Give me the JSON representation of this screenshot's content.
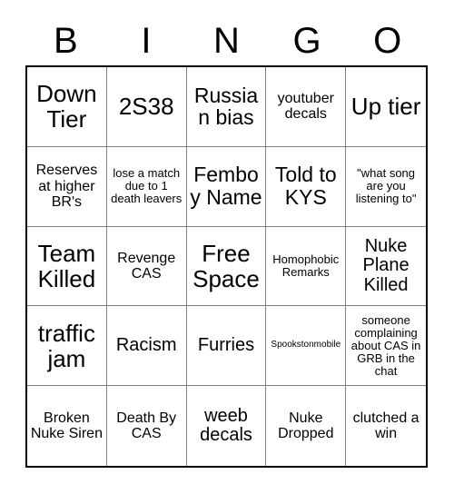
{
  "card": {
    "header_letters": [
      "B",
      "I",
      "N",
      "G",
      "O"
    ],
    "background_color": "#ffffff",
    "text_color": "#000000",
    "outer_border_color": "#000000",
    "inner_border_color": "#808080",
    "rows": 5,
    "columns": 5,
    "cells": [
      {
        "text": "Down Tier",
        "size": "fs-xl"
      },
      {
        "text": "2S38",
        "size": "fs-xl"
      },
      {
        "text": "Russian bias",
        "size": "fs-lg"
      },
      {
        "text": "youtuber decals",
        "size": "fs-sm"
      },
      {
        "text": "Up tier",
        "size": "fs-xl"
      },
      {
        "text": "Reserves at higher BR's",
        "size": "fs-sm"
      },
      {
        "text": "lose a match due to 1 death leavers",
        "size": "fs-xs"
      },
      {
        "text": "Femboy Name",
        "size": "fs-lg"
      },
      {
        "text": "Told to KYS",
        "size": "fs-lg"
      },
      {
        "text": "\"what song are you listening to\"",
        "size": "fs-xs"
      },
      {
        "text": "Team Killed",
        "size": "fs-xl"
      },
      {
        "text": "Revenge CAS",
        "size": "fs-sm"
      },
      {
        "text": "Free Space",
        "size": "fs-xl"
      },
      {
        "text": "Homophobic Remarks",
        "size": "fs-xs"
      },
      {
        "text": "Nuke Plane Killed",
        "size": "fs-md"
      },
      {
        "text": "traffic jam",
        "size": "fs-xl"
      },
      {
        "text": "Racism",
        "size": "fs-md"
      },
      {
        "text": "Furries",
        "size": "fs-md"
      },
      {
        "text": "Spookstonmobile",
        "size": "fs-xxs"
      },
      {
        "text": "someone complaining about CAS in GRB in the chat",
        "size": "fs-xs"
      },
      {
        "text": "Broken Nuke Siren",
        "size": "fs-sm"
      },
      {
        "text": "Death By CAS",
        "size": "fs-sm"
      },
      {
        "text": "weeb decals",
        "size": "fs-md"
      },
      {
        "text": "Nuke Dropped",
        "size": "fs-sm"
      },
      {
        "text": "clutched a win",
        "size": "fs-sm"
      }
    ]
  }
}
